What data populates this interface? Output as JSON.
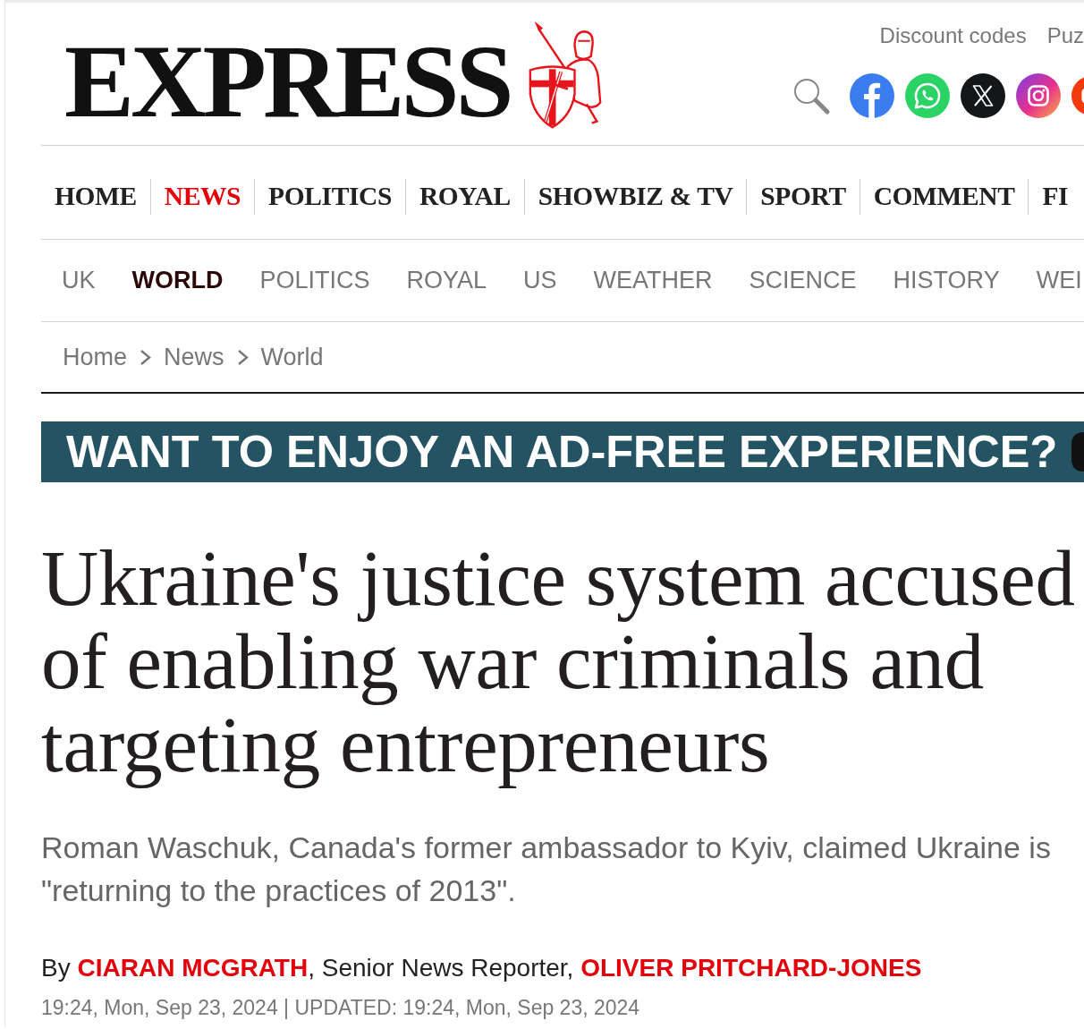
{
  "header": {
    "wordmark": "EXPRESS",
    "top_links": [
      "Discount codes",
      "Puz"
    ]
  },
  "main_nav": [
    {
      "label": "HOME",
      "selected": false
    },
    {
      "label": "NEWS",
      "selected": true
    },
    {
      "label": "POLITICS",
      "selected": false
    },
    {
      "label": "ROYAL",
      "selected": false
    },
    {
      "label": "SHOWBIZ & TV",
      "selected": false
    },
    {
      "label": "SPORT",
      "selected": false
    },
    {
      "label": "COMMENT",
      "selected": false
    },
    {
      "label": "FI",
      "selected": false
    }
  ],
  "section_nav": [
    {
      "label": "UK",
      "selected": false
    },
    {
      "label": "WORLD",
      "selected": true
    },
    {
      "label": "POLITICS",
      "selected": false
    },
    {
      "label": "ROYAL",
      "selected": false
    },
    {
      "label": "US",
      "selected": false
    },
    {
      "label": "WEATHER",
      "selected": false
    },
    {
      "label": "SCIENCE",
      "selected": false
    },
    {
      "label": "HISTORY",
      "selected": false
    },
    {
      "label": "WEI",
      "selected": false
    }
  ],
  "breadcrumb": [
    "Home",
    "News",
    "World"
  ],
  "banner": {
    "text": "WANT TO ENJOY AN AD-FREE EXPERIENCE?"
  },
  "article": {
    "headline": "Ukraine's justice system accused of enabling war criminals and targeting entrepreneurs",
    "standfirst": "Roman Waschuk, Canada's former ambassador to Kyiv, claimed Ukraine is \"returning to the practices of 2013\".",
    "byline": [
      {
        "kind": "text",
        "text": "By "
      },
      {
        "kind": "author",
        "text": "CIARAN MCGRATH"
      },
      {
        "kind": "text",
        "text": ", Senior News Reporter, "
      },
      {
        "kind": "author",
        "text": "OLIVER PRITCHARD-JONES"
      }
    ],
    "dateline": "19:24, Mon, Sep 23, 2024 | UPDATED: 19:24, Mon, Sep 23, 2024"
  }
}
